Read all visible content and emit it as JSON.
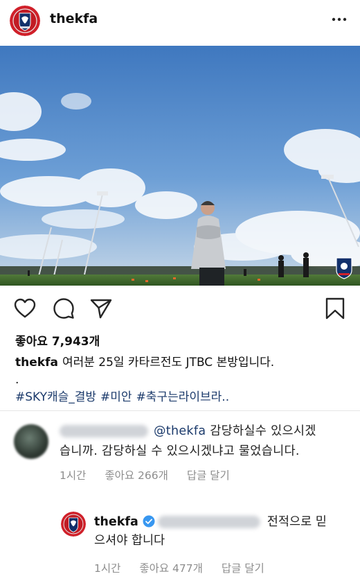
{
  "header": {
    "username": "thekfa",
    "avatar_icon": "kfa-tiger-emblem-icon",
    "more_icon": "more-dots-icon"
  },
  "post": {
    "photo_alt": "coach standing on training pitch",
    "actions": {
      "like_icon": "heart-icon",
      "comment_icon": "comment-bubble-icon",
      "share_icon": "paper-plane-icon",
      "save_icon": "bookmark-icon"
    },
    "likes_label": "좋아요",
    "likes_count": "7,943개",
    "caption": {
      "username": "thekfa",
      "text": "여러분 25일 카타르전도 JTBC 본방입니다.",
      "dot": ".",
      "hashtags": [
        "#SKY캐슬_결방",
        "#미안",
        "#축구는라이브라",
        ".."
      ]
    }
  },
  "comments": [
    {
      "mention": "@thekfa",
      "text_line1": " 감당하실수 있으시겠",
      "text_line2": "습니까. 감당하실 수 있으시겠냐고 물었습니다.",
      "time": "1시간",
      "likes": "좋아요 266개",
      "reply": "답글 달기"
    }
  ],
  "reply": {
    "username": "thekfa",
    "text_line1": "전적으로 믿",
    "text_line2": "으셔야 합니다",
    "time": "1시간",
    "likes": "좋아요 477개",
    "reply": "답글 달기"
  },
  "colors": {
    "sky_top": "#4f86c8",
    "sky_bottom": "#b9d0e6",
    "grass": "#3f6a2c",
    "hashtag": "#1b3a6b",
    "verified": "#3897f0",
    "kfa_red": "#d0202a"
  }
}
